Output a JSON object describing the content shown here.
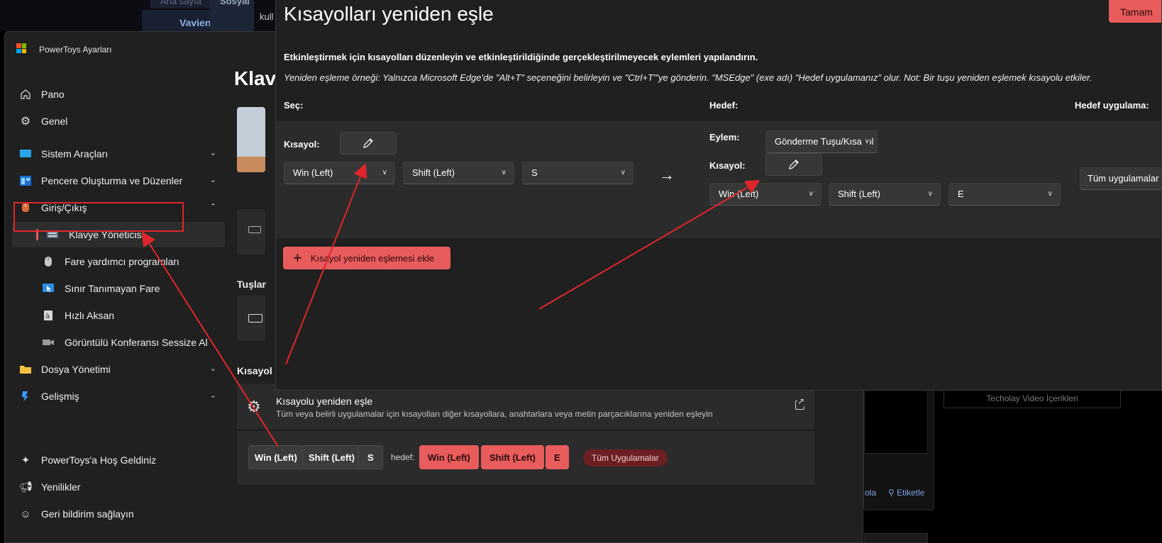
{
  "background": {
    "tab1": "Ana sayfa",
    "tab2": "Sosyal",
    "strip_label": "Vavien.",
    "small_text": "kull",
    "right_button": "Techolay Video İçerikleri",
    "link1": "ola",
    "link2": "Etiketle"
  },
  "powertoys": {
    "app_title": "PowerToys Ayarları",
    "content_title": "Klav",
    "section_keys": "Tuşlar",
    "section_shortcuts": "Kısayol",
    "nav": [
      {
        "label": "Pano"
      },
      {
        "label": "Genel"
      },
      {
        "label": "Sistem Araçları"
      },
      {
        "label": "Pencere Oluşturma ve Düzenler"
      },
      {
        "label": "Giriş/Çıkış"
      },
      {
        "label": "Klavye Yöneticisi"
      },
      {
        "label": "Fare yardımcı programları"
      },
      {
        "label": "Sınır Tanımayan Fare"
      },
      {
        "label": "Hızlı Aksan"
      },
      {
        "label": "Görüntülü Konferansı Sessize Al"
      },
      {
        "label": "Dosya Yönetimi"
      },
      {
        "label": "Gelişmiş"
      }
    ],
    "nav_bottom": [
      {
        "label": "PowerToys'a Hoş Geldiniz"
      },
      {
        "label": "Yenilikler"
      },
      {
        "label": "Geri bildirim sağlayın"
      }
    ],
    "remap_card": {
      "title": "Kısayolu yeniden eşle",
      "description": "Tüm veya belirli uygulamalar için kısayolları diğer kısayollara, anahtarlara veya metin parçacıklarına yeniden eşleyin"
    },
    "mapping": {
      "from": [
        "Win (Left)",
        "Shift (Left)",
        "S"
      ],
      "to_label": "hedef:",
      "to": [
        "Win (Left)",
        "Shift (Left)",
        "E"
      ],
      "app": "Tüm Uygulamalar"
    }
  },
  "dialog": {
    "title": "Kısayolları yeniden eşle",
    "ok_button": "Tamam",
    "description_bold": "Etkinleştirmek için kısayolları düzenleyin ve etkinleştirildiğinde gerçekleştirilmeyecek eylemleri yapılandırın.",
    "description_example": "Yeniden eşleme örneği: Yalnızca Microsoft Edge'de \"Alt+T\" seçeneğini belirleyin ve \"Ctrl+T\"'ye gönderin. \"MSEdge\" (exe adı) \"Hedef uygulamanız\" olur. Not: Bir tuşu yeniden eşlemek kısayolu etkiler.",
    "col_select": "Seç:",
    "col_target": "Hedef:",
    "col_target_app": "Hedef uygulama:",
    "shortcut_label": "Kısayol:",
    "action_label": "Eylem:",
    "action_value": "Gönderme Tuşu/Kısayol",
    "source_keys": [
      "Win (Left)",
      "Shift (Left)",
      "S"
    ],
    "target_keys": [
      "Win (Left)",
      "Shift (Left)",
      "E"
    ],
    "target_app_value": "Tüm uygulamalar",
    "add_button": "Kısayol yeniden eşlemesi ekle"
  },
  "colors": {
    "accent": "#e85c5c",
    "annotation": "#e0262a"
  }
}
